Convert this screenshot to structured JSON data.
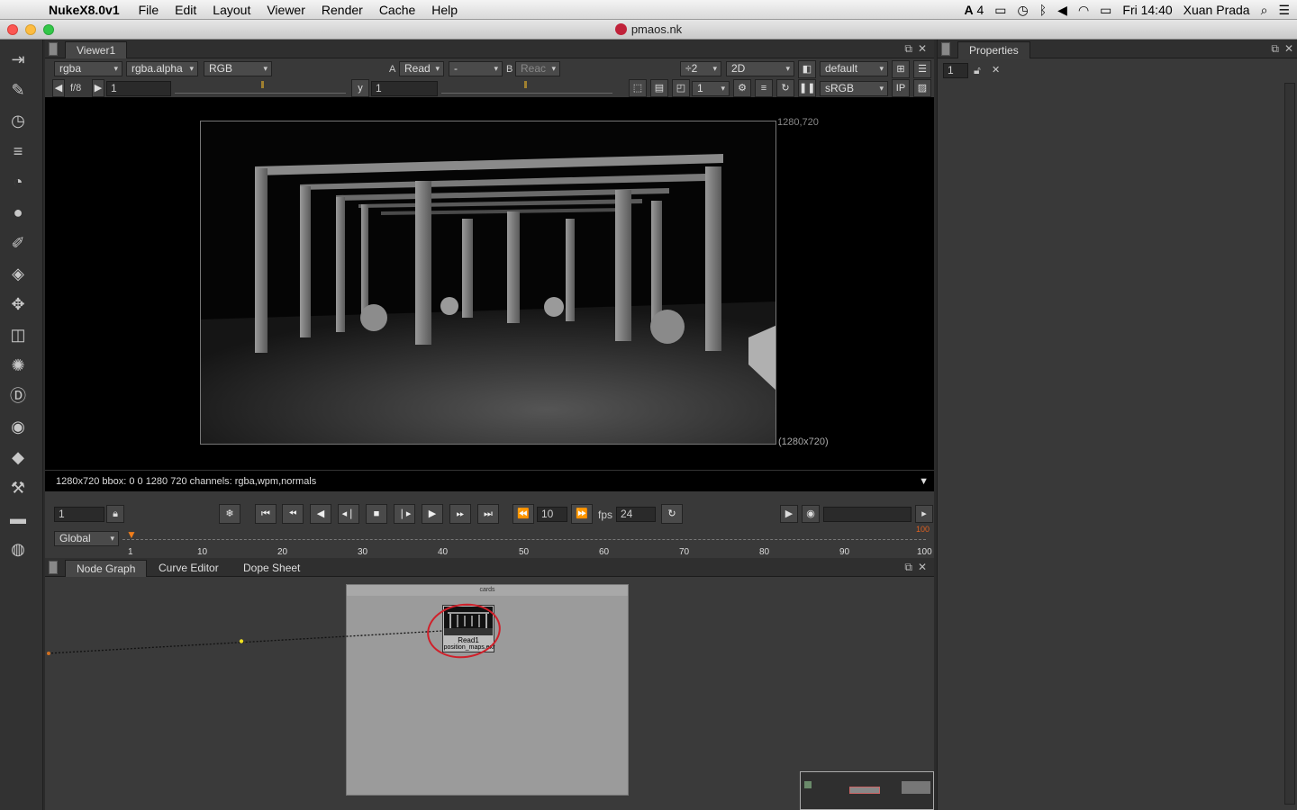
{
  "menubar": {
    "apple_icon": "apple-icon",
    "app": "NukeX8.0v1",
    "items": [
      "File",
      "Edit",
      "Layout",
      "Viewer",
      "Render",
      "Cache",
      "Help"
    ],
    "status": {
      "adobe": "4",
      "clock": "Fri 14:40",
      "user": "Xuan Prada"
    }
  },
  "window": {
    "title": "pmaos.nk"
  },
  "toolbar": {
    "icons": [
      "image-icon",
      "draw-icon",
      "time-icon",
      "channel-icon",
      "color-icon",
      "filter-icon",
      "keyer-icon",
      "merge-icon",
      "transform-icon",
      "3d-icon",
      "particles-icon",
      "deep-icon",
      "views-icon",
      "metadata-icon",
      "toolsets-icon",
      "other-icon",
      "furnace-icon"
    ]
  },
  "viewer": {
    "tab": "Viewer1",
    "channels": "rgba",
    "alpha": "rgba.alpha",
    "display": "RGB",
    "a_label": "A",
    "a_input": "Read",
    "op": "-",
    "b_label": "B",
    "b_input": "Reac",
    "downscale": "÷2",
    "mode": "2D",
    "lut": "default",
    "fstop": "f/8",
    "gain": "1",
    "y_label": "y",
    "gamma": "1",
    "roi_frame": "1",
    "colorspace": "sRGB",
    "ip": "IP",
    "coord_tr": "1280,720",
    "coord_br": "(1280x720)",
    "info": "1280x720 bbox: 0 0 1280 720 channels: rgba,wpm,normals"
  },
  "transport": {
    "frame": "1",
    "step": "10",
    "fps_label": "fps",
    "fps": "24",
    "range": "Global",
    "end_frame": "100",
    "ticks": [
      "1",
      "10",
      "20",
      "30",
      "40",
      "50",
      "60",
      "70",
      "80",
      "90",
      "100"
    ]
  },
  "nodegraph": {
    "tabs": [
      "Node Graph",
      "Curve Editor",
      "Dope Sheet"
    ],
    "backdrop": "cards",
    "node_name": "Read1",
    "node_file": "position_maps.exr"
  },
  "properties": {
    "tab": "Properties",
    "max_panels": "1"
  }
}
